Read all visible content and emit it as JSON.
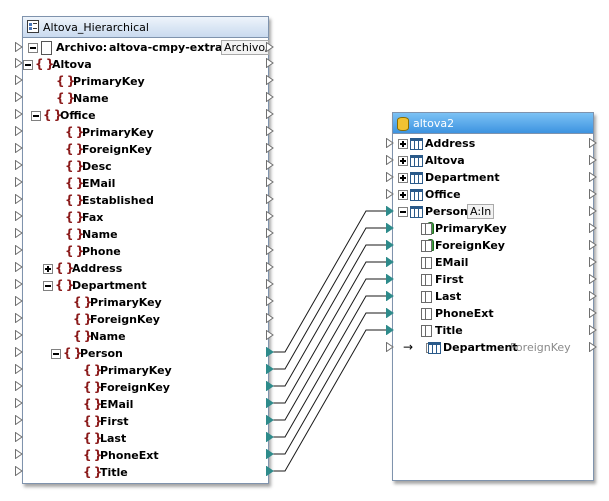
{
  "left_component": {
    "title": "Altova_Hierarchical",
    "root": {
      "label": "Archivo:",
      "value": "altova-cmpy-extra.xml",
      "button": "Archivo/"
    },
    "items": [
      {
        "label": "Altova"
      },
      {
        "label": "PrimaryKey"
      },
      {
        "label": "Name"
      },
      {
        "label": "Office"
      },
      {
        "label": "PrimaryKey"
      },
      {
        "label": "ForeignKey"
      },
      {
        "label": "Desc"
      },
      {
        "label": "EMail"
      },
      {
        "label": "Established"
      },
      {
        "label": "Fax"
      },
      {
        "label": "Name"
      },
      {
        "label": "Phone"
      },
      {
        "label": "Address"
      },
      {
        "label": "Department"
      },
      {
        "label": "PrimaryKey"
      },
      {
        "label": "ForeignKey"
      },
      {
        "label": "Name"
      },
      {
        "label": "Person"
      },
      {
        "label": "PrimaryKey"
      },
      {
        "label": "ForeignKey"
      },
      {
        "label": "EMail"
      },
      {
        "label": "First"
      },
      {
        "label": "Last"
      },
      {
        "label": "PhoneExt"
      },
      {
        "label": "Title"
      }
    ]
  },
  "right_component": {
    "title": "altova2",
    "items": [
      {
        "label": "Address"
      },
      {
        "label": "Altova"
      },
      {
        "label": "Department"
      },
      {
        "label": "Office"
      },
      {
        "label": "Person",
        "tag": "A:In"
      },
      {
        "label": "PrimaryKey"
      },
      {
        "label": "ForeignKey"
      },
      {
        "label": "EMail"
      },
      {
        "label": "First"
      },
      {
        "label": "Last"
      },
      {
        "label": "PhoneExt"
      },
      {
        "label": "Title"
      },
      {
        "label": "Department",
        "tag": "ForeignKey"
      }
    ]
  },
  "colors": {
    "connector_line": "#1a1a1a",
    "connector_dot": "#2e8b8b",
    "right_title_bar": "#3d93e0",
    "element_icon": "#8b1a1a"
  }
}
